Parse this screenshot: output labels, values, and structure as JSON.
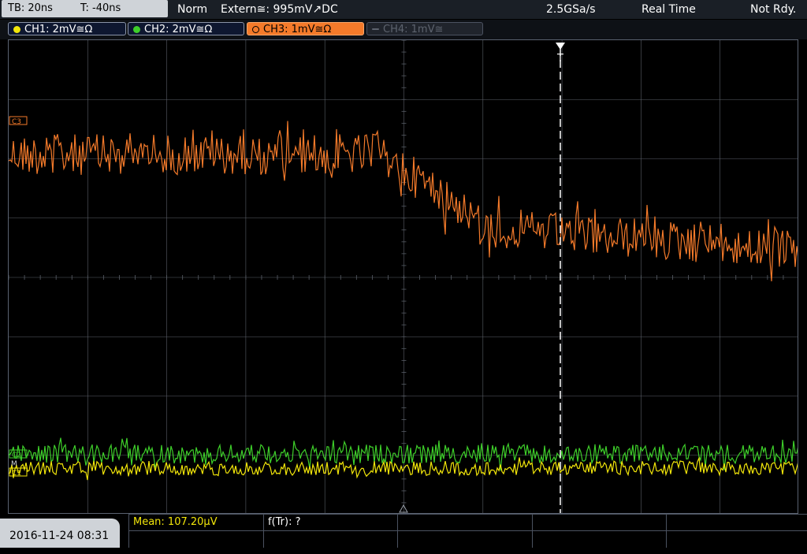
{
  "status": {
    "timebase": "TB: 20ns",
    "trigger_offset": "T: -40ns",
    "trigger_mode": "Norm",
    "trigger_source": "Extern≅: 995mV↗DC",
    "sample_rate": "2.5GSa/s",
    "acquisition_mode": "Real Time",
    "ready_state": "Not Rdy."
  },
  "channels": [
    {
      "label": "CH1: 2mV≅Ω",
      "color": "#f2e60a",
      "state": "on"
    },
    {
      "label": "CH2: 2mV≅Ω",
      "color": "#3ecf2a",
      "state": "on"
    },
    {
      "label": "CH3: 1mV≅Ω",
      "color": "#f47a2a",
      "state": "active"
    },
    {
      "label": "CH4: 1mV≅",
      "color": "#5d636e",
      "state": "off"
    }
  ],
  "markers": {
    "trigger_marker": "T",
    "ch3_marker": "C3",
    "ch2_marker": "C2",
    "ch1_marker": "C1",
    "reference": "M"
  },
  "measurements": {
    "mean": "Mean: 107.20µV",
    "rise_freq": "f(Tr): ?"
  },
  "datetime": "2016-11-24 08:31",
  "colors": {
    "ch1": "#f2e60a",
    "ch2": "#3ecf2a",
    "ch3": "#f47a2a",
    "grid": "#5a5f68",
    "trigger_line": "#ffffff"
  }
}
